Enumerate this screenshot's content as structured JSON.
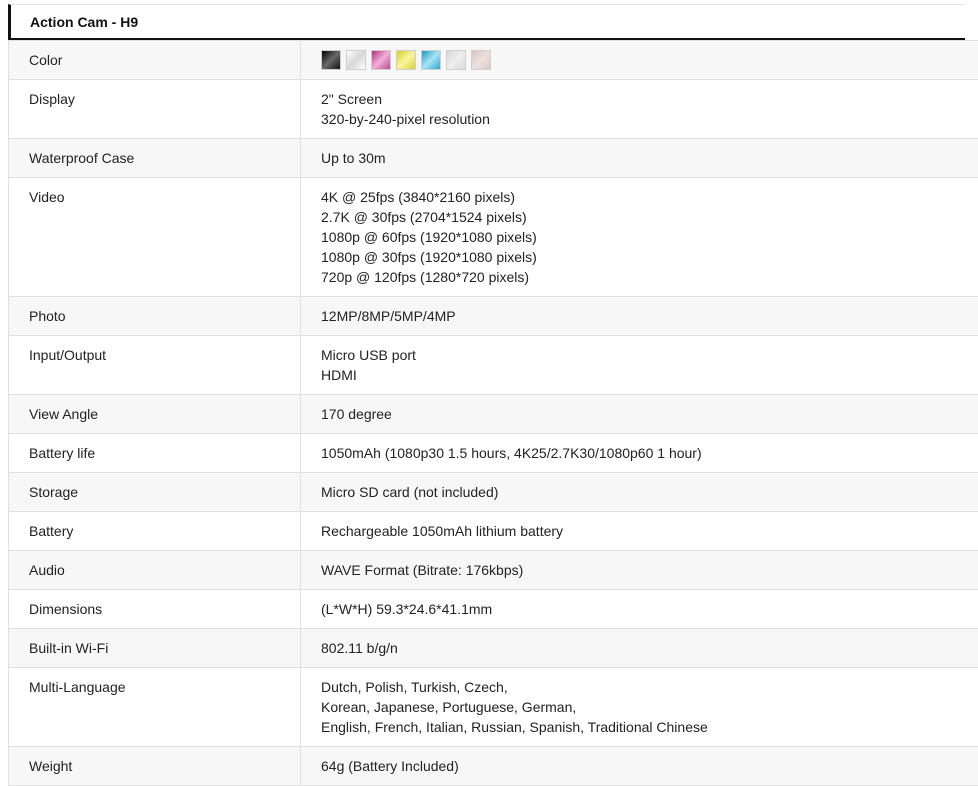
{
  "title": "Action Cam - H9",
  "colors": [
    {
      "name": "black",
      "from": "#000000",
      "mid": "#6a6a6a",
      "to": "#111111"
    },
    {
      "name": "white",
      "from": "#ffffff",
      "mid": "#d8d8d8",
      "to": "#ffffff"
    },
    {
      "name": "pink",
      "from": "#b0307a",
      "mid": "#f0b0d8",
      "to": "#c04a90"
    },
    {
      "name": "yellow",
      "from": "#d8d020",
      "mid": "#f8f4a0",
      "to": "#dcd430"
    },
    {
      "name": "blue",
      "from": "#1a9ac0",
      "mid": "#a8e4f4",
      "to": "#2aa8d0"
    },
    {
      "name": "silver",
      "from": "#d6d6d6",
      "mid": "#eeeeee",
      "to": "#dadada"
    },
    {
      "name": "rose-gold",
      "from": "#d8c4c0",
      "mid": "#ece0dc",
      "to": "#dccac6"
    }
  ],
  "rows": [
    {
      "label": "Color",
      "lines": []
    },
    {
      "label": "Display",
      "lines": [
        "2\" Screen",
        "320-by-240-pixel resolution"
      ]
    },
    {
      "label": "Waterproof Case",
      "lines": [
        "Up to 30m"
      ]
    },
    {
      "label": "Video",
      "lines": [
        "4K @ 25fps (3840*2160 pixels)",
        "2.7K @ 30fps (2704*1524 pixels)",
        "1080p @ 60fps (1920*1080 pixels)",
        "1080p @ 30fps (1920*1080 pixels)",
        "720p @ 120fps (1280*720 pixels)"
      ]
    },
    {
      "label": "Photo",
      "lines": [
        "12MP/8MP/5MP/4MP"
      ]
    },
    {
      "label": "Input/Output",
      "lines": [
        "Micro USB port",
        "HDMI"
      ]
    },
    {
      "label": "View Angle",
      "lines": [
        "170 degree"
      ]
    },
    {
      "label": "Battery life",
      "lines": [
        "1050mAh (1080p30 1.5 hours, 4K25/2.7K30/1080p60 1 hour)"
      ]
    },
    {
      "label": "Storage",
      "lines": [
        "Micro SD card (not included)"
      ]
    },
    {
      "label": "Battery",
      "lines": [
        "Rechargeable 1050mAh lithium battery"
      ]
    },
    {
      "label": "Audio",
      "lines": [
        "WAVE Format (Bitrate: 176kbps)"
      ]
    },
    {
      "label": "Dimensions",
      "lines": [
        "(L*W*H) 59.3*24.6*41.1mm"
      ]
    },
    {
      "label": "Built-in Wi-Fi",
      "lines": [
        "802.11 b/g/n"
      ]
    },
    {
      "label": "Multi-Language",
      "lines": [
        "Dutch, Polish, Turkish, Czech,",
        "Korean, Japanese, Portuguese, German,",
        "English, French, Italian, Russian, Spanish, Traditional Chinese"
      ]
    },
    {
      "label": "Weight",
      "lines": [
        "64g (Battery Included)"
      ]
    }
  ]
}
